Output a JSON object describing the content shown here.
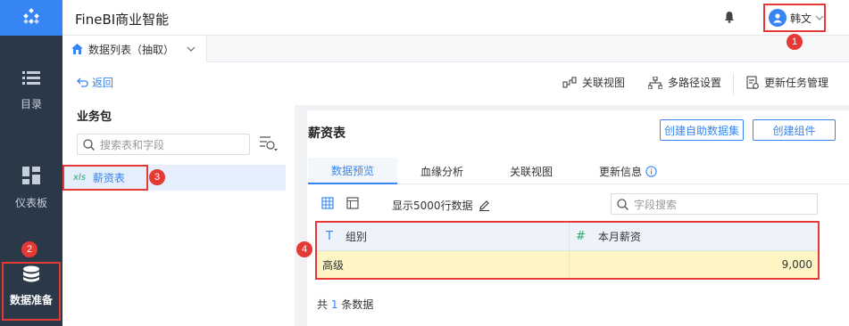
{
  "header": {
    "app_title": "FineBI商业智能",
    "user_name": "韩文"
  },
  "sidebar": {
    "items": [
      {
        "label": "目录"
      },
      {
        "label": "仪表板"
      },
      {
        "label": "数据准备"
      }
    ]
  },
  "tabbar": {
    "active_tab": "数据列表（抽取）"
  },
  "toolbar": {
    "back_label": "返回",
    "actions": [
      {
        "label": "关联视图"
      },
      {
        "label": "多路径设置"
      },
      {
        "label": "更新任务管理"
      }
    ]
  },
  "package_panel": {
    "title": "业务包",
    "search_placeholder": "搜索表和字段",
    "tables": [
      {
        "type": "xls",
        "name": "薪资表"
      }
    ]
  },
  "table_panel": {
    "title": "薪资表",
    "buttons": [
      {
        "label": "创建自助数据集"
      },
      {
        "label": "创建组件"
      }
    ],
    "tabs": [
      {
        "label": "数据预览",
        "active": true
      },
      {
        "label": "血缘分析"
      },
      {
        "label": "关联视图"
      },
      {
        "label": "更新信息"
      }
    ],
    "row_limit_label": "显示5000行数据",
    "field_search_placeholder": "字段搜索",
    "columns": [
      {
        "type_symbol": "T",
        "name": "组别"
      },
      {
        "type_symbol": "#",
        "name": "本月薪资"
      }
    ],
    "rows": [
      [
        "高级",
        "9,000"
      ]
    ],
    "footer": {
      "prefix": "共",
      "count": "1",
      "suffix": "条数据"
    }
  },
  "badges": [
    "1",
    "2",
    "3",
    "4"
  ],
  "colors": {
    "brand": "#3685f2",
    "rail": "#2b3848",
    "highlight": "#e53935",
    "row_highlight": "#fdf6c4"
  }
}
